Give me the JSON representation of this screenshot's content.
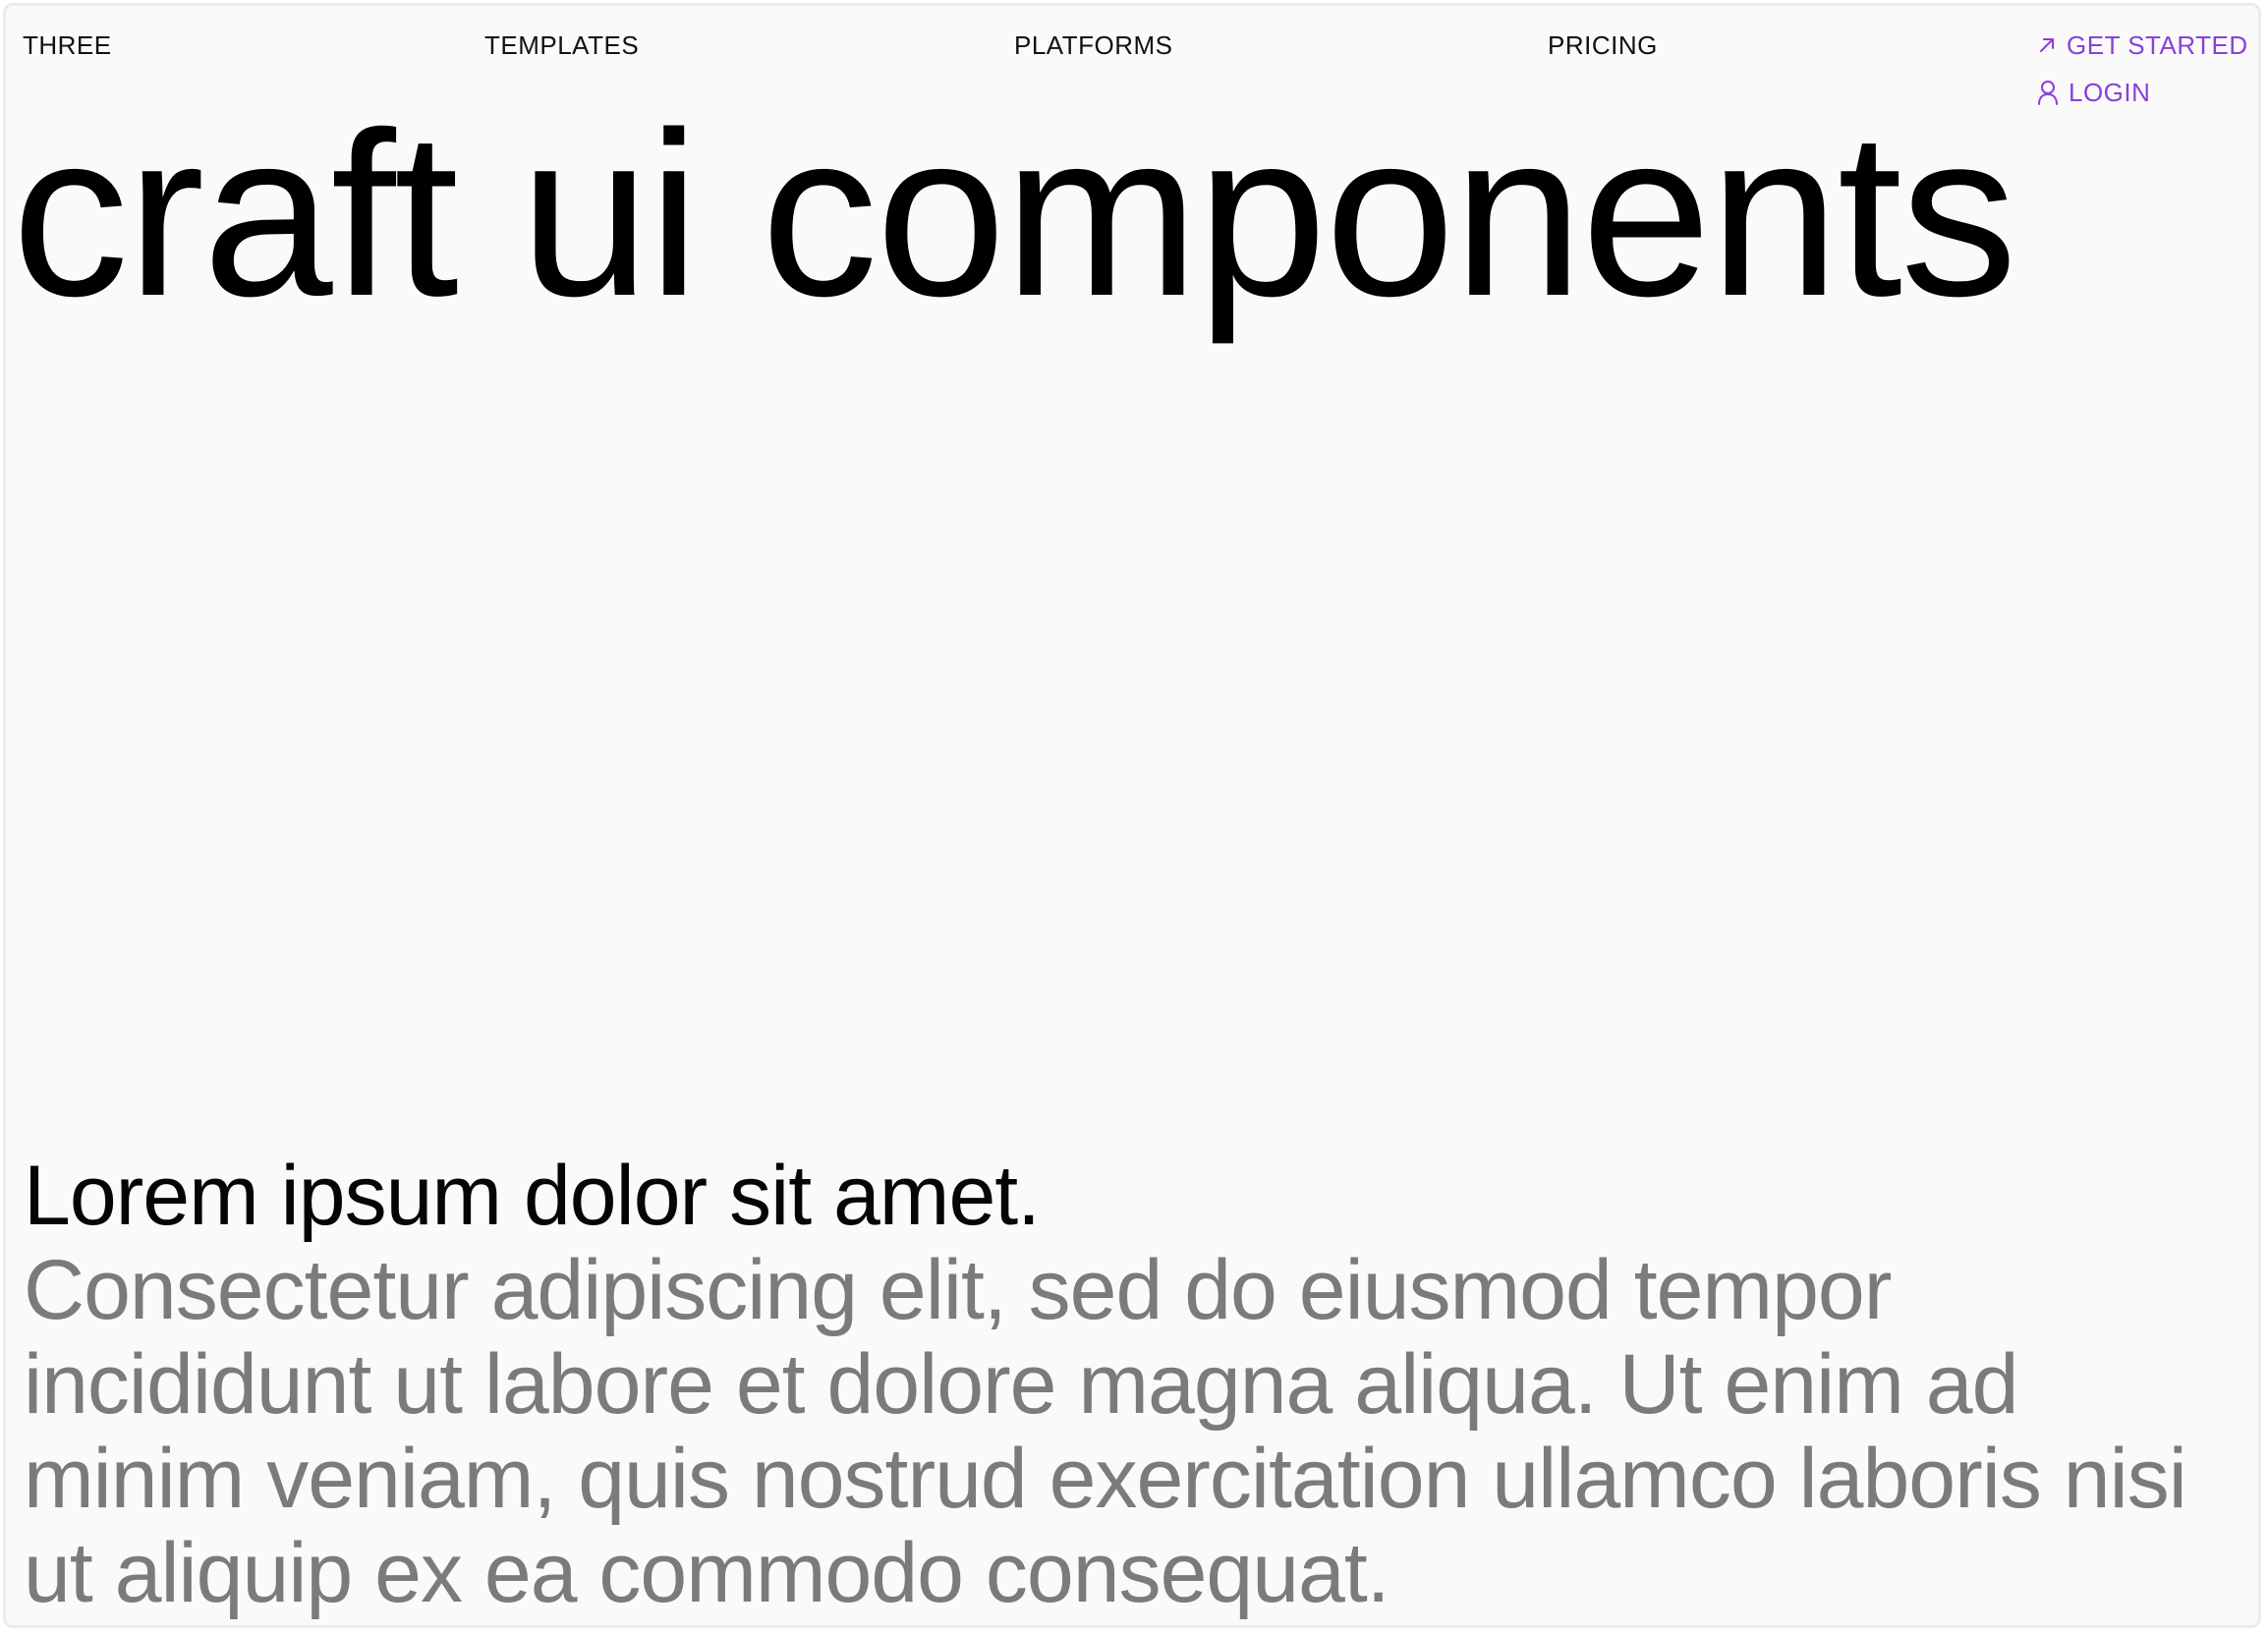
{
  "nav": {
    "brand": "THREE",
    "links": [
      "TEMPLATES",
      "PLATFORMS",
      "PRICING"
    ]
  },
  "actions": {
    "get_started": "GET STARTED",
    "login": "LOGIN",
    "get_started_icon": "arrow-up-right-icon",
    "login_icon": "user-icon",
    "accent_color": "#8b3fd9"
  },
  "hero": {
    "title": "craft ui components"
  },
  "copy": {
    "lead": "Lorem ipsum dolor sit amet.",
    "body": "Consectetur adipiscing elit, sed do eiusmod tempor incididunt ut labore et dolore magna aliqua. Ut enim ad minim veniam, quis nostrud exercitation ullamco laboris nisi ut aliquip ex ea commodo consequat."
  }
}
